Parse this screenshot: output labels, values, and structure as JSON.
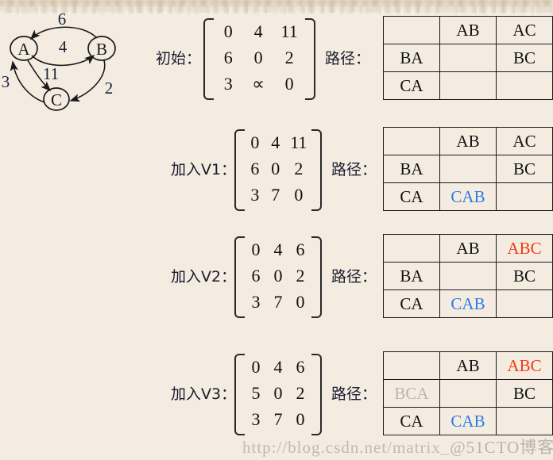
{
  "graph": {
    "nodes": [
      {
        "id": "A",
        "label": "A"
      },
      {
        "id": "B",
        "label": "B"
      },
      {
        "id": "C",
        "label": "C"
      }
    ],
    "edges": [
      {
        "from": "B",
        "to": "A",
        "weight": "6"
      },
      {
        "from": "A",
        "to": "B",
        "weight": "4"
      },
      {
        "from": "A",
        "to": "C",
        "weight": "11"
      },
      {
        "from": "C",
        "to": "A",
        "weight": "3"
      },
      {
        "from": "B",
        "to": "C",
        "weight": "2"
      }
    ]
  },
  "steps": [
    {
      "label": "初始：",
      "path_label": "路径：",
      "matrix": [
        [
          {
            "v": "0",
            "c": "black"
          },
          {
            "v": "4",
            "c": "black"
          },
          {
            "v": "11",
            "c": "black"
          }
        ],
        [
          {
            "v": "6",
            "c": "black"
          },
          {
            "v": "0",
            "c": "black"
          },
          {
            "v": "2",
            "c": "black"
          }
        ],
        [
          {
            "v": "3",
            "c": "black"
          },
          {
            "v": "∝",
            "c": "black"
          },
          {
            "v": "0",
            "c": "black"
          }
        ]
      ],
      "paths": [
        [
          {
            "v": "",
            "c": "black"
          },
          {
            "v": "AB",
            "c": "black"
          },
          {
            "v": "AC",
            "c": "black"
          }
        ],
        [
          {
            "v": "BA",
            "c": "black"
          },
          {
            "v": "",
            "c": "black"
          },
          {
            "v": "BC",
            "c": "black"
          }
        ],
        [
          {
            "v": "CA",
            "c": "black"
          },
          {
            "v": "",
            "c": "black"
          },
          {
            "v": "",
            "c": "black"
          }
        ]
      ]
    },
    {
      "label": "加入V1：",
      "path_label": "路径：",
      "matrix": [
        [
          {
            "v": "0",
            "c": "black"
          },
          {
            "v": "4",
            "c": "black"
          },
          {
            "v": "11",
            "c": "black"
          }
        ],
        [
          {
            "v": "6",
            "c": "black"
          },
          {
            "v": "0",
            "c": "black"
          },
          {
            "v": "2",
            "c": "black"
          }
        ],
        [
          {
            "v": "3",
            "c": "black"
          },
          {
            "v": "7",
            "c": "blue"
          },
          {
            "v": "0",
            "c": "black"
          }
        ]
      ],
      "paths": [
        [
          {
            "v": "",
            "c": "black"
          },
          {
            "v": "AB",
            "c": "black"
          },
          {
            "v": "AC",
            "c": "black"
          }
        ],
        [
          {
            "v": "BA",
            "c": "black"
          },
          {
            "v": "",
            "c": "black"
          },
          {
            "v": "BC",
            "c": "black"
          }
        ],
        [
          {
            "v": "CA",
            "c": "black"
          },
          {
            "v": "CAB",
            "c": "blue"
          },
          {
            "v": "",
            "c": "black"
          }
        ]
      ]
    },
    {
      "label": "加入V2：",
      "path_label": "路径：",
      "matrix": [
        [
          {
            "v": "0",
            "c": "black"
          },
          {
            "v": "4",
            "c": "black"
          },
          {
            "v": "6",
            "c": "red"
          }
        ],
        [
          {
            "v": "6",
            "c": "black"
          },
          {
            "v": "0",
            "c": "black"
          },
          {
            "v": "2",
            "c": "black"
          }
        ],
        [
          {
            "v": "3",
            "c": "black"
          },
          {
            "v": "7",
            "c": "blue"
          },
          {
            "v": "0",
            "c": "black"
          }
        ]
      ],
      "paths": [
        [
          {
            "v": "",
            "c": "black"
          },
          {
            "v": "AB",
            "c": "black"
          },
          {
            "v": "ABC",
            "c": "red"
          }
        ],
        [
          {
            "v": "BA",
            "c": "black"
          },
          {
            "v": "",
            "c": "black"
          },
          {
            "v": "BC",
            "c": "black"
          }
        ],
        [
          {
            "v": "CA",
            "c": "black"
          },
          {
            "v": "CAB",
            "c": "blue"
          },
          {
            "v": "",
            "c": "black"
          }
        ]
      ]
    },
    {
      "label": "加入V3：",
      "path_label": "路径：",
      "matrix": [
        [
          {
            "v": "0",
            "c": "black"
          },
          {
            "v": "4",
            "c": "black"
          },
          {
            "v": "6",
            "c": "red"
          }
        ],
        [
          {
            "v": "5",
            "c": "gray"
          },
          {
            "v": "0",
            "c": "black"
          },
          {
            "v": "2",
            "c": "black"
          }
        ],
        [
          {
            "v": "3",
            "c": "black"
          },
          {
            "v": "7",
            "c": "blue"
          },
          {
            "v": "0",
            "c": "black"
          }
        ]
      ],
      "paths": [
        [
          {
            "v": "",
            "c": "black"
          },
          {
            "v": "AB",
            "c": "black"
          },
          {
            "v": "ABC",
            "c": "red"
          }
        ],
        [
          {
            "v": "BCA",
            "c": "gray"
          },
          {
            "v": "",
            "c": "black"
          },
          {
            "v": "BC",
            "c": "black"
          }
        ],
        [
          {
            "v": "CA",
            "c": "black"
          },
          {
            "v": "CAB",
            "c": "blue"
          },
          {
            "v": "",
            "c": "black"
          }
        ]
      ]
    }
  ],
  "watermark": {
    "url": "http://blog.csdn.net/matrix_",
    "site": "@51CTO博客"
  },
  "colors": {
    "background": "#f4ece0",
    "blue": "#2b7ce8",
    "red": "#f03b14",
    "gray": "#b8b4aa",
    "ink": "#111111"
  }
}
